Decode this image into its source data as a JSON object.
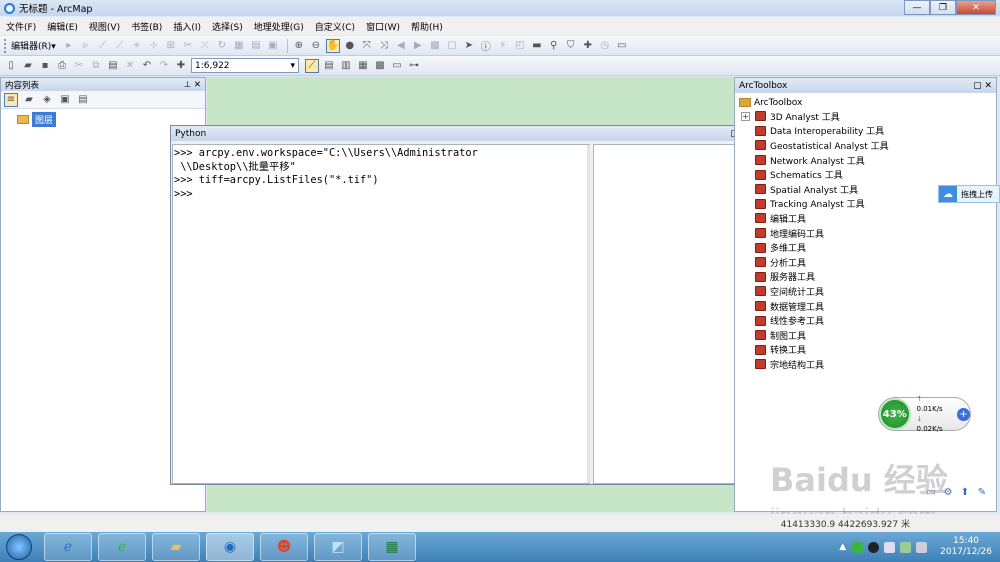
{
  "window": {
    "title": "无标题 - ArcMap"
  },
  "menu": [
    "文件(F)",
    "编辑(E)",
    "视图(V)",
    "书签(B)",
    "插入(I)",
    "选择(S)",
    "地理处理(G)",
    "自定义(C)",
    "窗口(W)",
    "帮助(H)"
  ],
  "toolbar1": {
    "editor_label": "编辑器(R)▾"
  },
  "toolbar2": {
    "scale": "1:6,922"
  },
  "toc": {
    "title": "内容列表",
    "layers_label": "图层"
  },
  "python": {
    "title": "Python",
    "console_lines": [
      ">>> arcpy.env.workspace=\"C:\\\\Users\\\\Administrator",
      " \\\\Desktop\\\\批量平移\"",
      ">>> tiff=arcpy.ListFiles(\"*.tif\")",
      ">>>"
    ]
  },
  "arctoolbox": {
    "title": "ArcToolbox",
    "root_label": "ArcToolbox",
    "items": [
      {
        "label": "3D Analyst 工具",
        "expandable": true
      },
      {
        "label": "Data Interoperability 工具",
        "expandable": false
      },
      {
        "label": "Geostatistical Analyst 工具",
        "expandable": false
      },
      {
        "label": "Network Analyst 工具",
        "expandable": false
      },
      {
        "label": "Schematics 工具",
        "expandable": false
      },
      {
        "label": "Spatial Analyst 工具",
        "expandable": false
      },
      {
        "label": "Tracking Analyst 工具",
        "expandable": false
      },
      {
        "label": "编辑工具",
        "expandable": false
      },
      {
        "label": "地理编码工具",
        "expandable": false
      },
      {
        "label": "多维工具",
        "expandable": false
      },
      {
        "label": "分析工具",
        "expandable": false
      },
      {
        "label": "服务器工具",
        "expandable": false
      },
      {
        "label": "空间统计工具",
        "expandable": false
      },
      {
        "label": "数据管理工具",
        "expandable": false
      },
      {
        "label": "线性参考工具",
        "expandable": false
      },
      {
        "label": "制图工具",
        "expandable": false
      },
      {
        "label": "转换工具",
        "expandable": false
      },
      {
        "label": "宗地结构工具",
        "expandable": false
      }
    ]
  },
  "side_widget": {
    "label": "拖拽上传"
  },
  "speed_widget": {
    "percent": "43%",
    "up": "0.01K/s",
    "down": "0.02K/s"
  },
  "statusbar": {
    "coords": "41413330.9 4422693.927 米"
  },
  "taskbar": {
    "clock_time": "15:40",
    "clock_date": "2017/12/26"
  },
  "watermark": {
    "main": "Baidu 经验",
    "sub": "jingyan.baidu.com"
  },
  "colors": {
    "map_background": "#c7e6c8",
    "title_gradient": "#c5d7ee",
    "taskbar": "#3e7fb6",
    "toolbox_red": "#c23b2d"
  }
}
